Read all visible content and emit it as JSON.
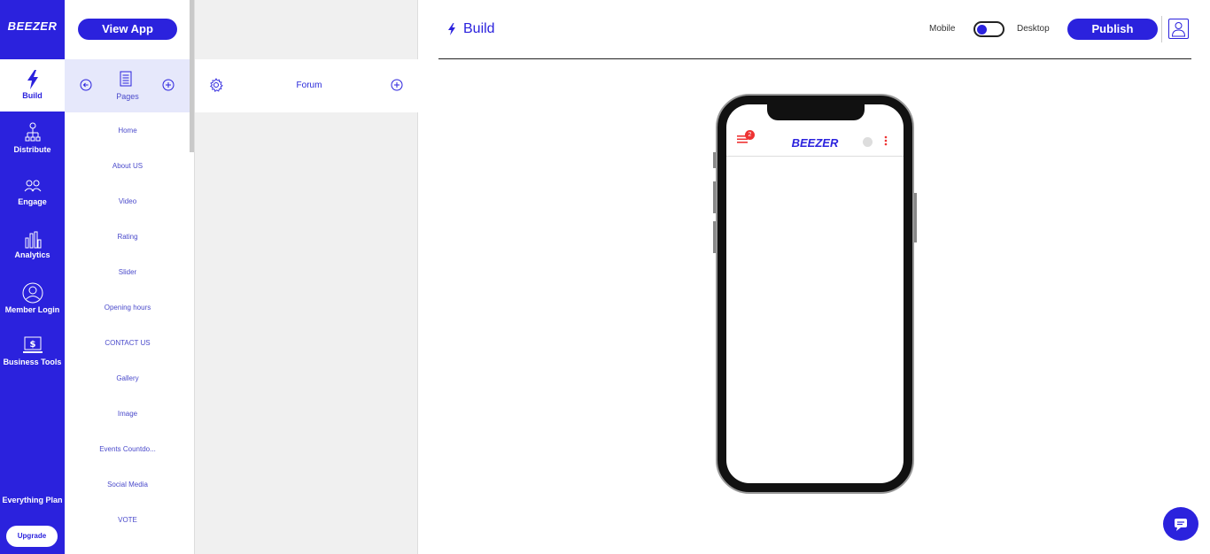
{
  "brand": {
    "logo_text": "BEEZER"
  },
  "leftnav": {
    "items": [
      {
        "label": "Build",
        "icon": "bolt-icon",
        "active": true
      },
      {
        "label": "Distribute",
        "icon": "network-icon"
      },
      {
        "label": "Engage",
        "icon": "users-icon"
      },
      {
        "label": "Analytics",
        "icon": "bar-chart-icon"
      },
      {
        "label": "Member Login",
        "icon": "user-circle-icon"
      },
      {
        "label": "Business Tools",
        "icon": "monitor-dollar-icon"
      }
    ],
    "plan_label": "Everything Plan",
    "upgrade_label": "Upgrade"
  },
  "pages_panel": {
    "view_app_label": "View App",
    "header_label": "Pages",
    "items": [
      "Home",
      "About US",
      "Video",
      "Rating",
      "Slider",
      "Opening hours",
      "CONTACT US",
      "Gallery",
      "Image",
      "Events Countdo...",
      "Social Media",
      "VOTE"
    ]
  },
  "sub_panel": {
    "item_label": "Forum"
  },
  "topbar": {
    "title": "Build",
    "mobile_label": "Mobile",
    "desktop_label": "Desktop",
    "publish_label": "Publish"
  },
  "preview": {
    "notification_count": "2",
    "app_logo_text": "BEEZER"
  },
  "colors": {
    "brand": "#2b22dd",
    "badge": "#ee3333"
  }
}
